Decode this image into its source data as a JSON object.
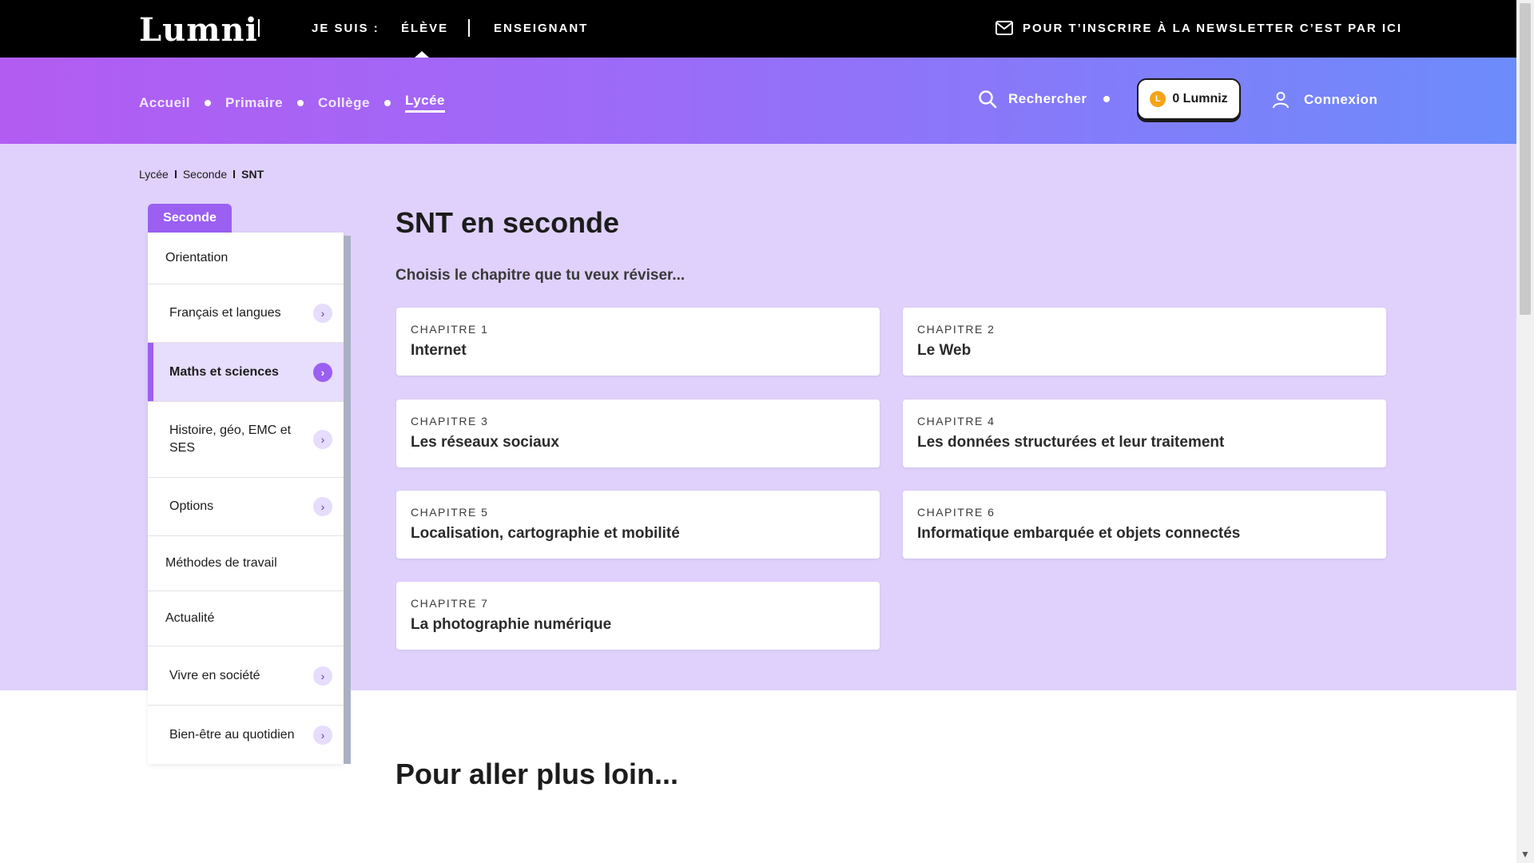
{
  "topbar": {
    "logo": "Lumni",
    "je_suis": "JE SUIS :",
    "eleve": "ÉLÈVE",
    "enseignant": "ENSEIGNANT",
    "newsletter": "POUR T’INSCRIRE À LA NEWSLETTER C’EST PAR ICI"
  },
  "nav": {
    "links": [
      "Accueil",
      "Primaire",
      "Collège",
      "Lycée"
    ],
    "active": "Lycée",
    "search": "Rechercher",
    "lumniz": "0 Lumniz",
    "coin_letter": "L",
    "connexion": "Connexion"
  },
  "breadcrumb": [
    "Lycée",
    "Seconde",
    "SNT"
  ],
  "sidebar": {
    "tab": "Seconde",
    "items": [
      {
        "label": "Orientation",
        "chevron": false
      },
      {
        "label": "Français et langues",
        "chevron": true
      },
      {
        "label": "Maths et sciences",
        "chevron": true,
        "active": true
      },
      {
        "label": "Histoire, géo, EMC et SES",
        "chevron": true
      },
      {
        "label": "Options",
        "chevron": true
      },
      {
        "label": "Méthodes de travail",
        "chevron": false
      },
      {
        "label": "Actualité",
        "chevron": false
      },
      {
        "label": "Vivre en société",
        "chevron": true
      },
      {
        "label": "Bien-être au quotidien",
        "chevron": true
      }
    ]
  },
  "main": {
    "title": "SNT en seconde",
    "subtitle": "Choisis le chapitre que tu veux réviser...",
    "chapters": [
      {
        "num": "CHAPITRE 1",
        "name": "Internet"
      },
      {
        "num": "CHAPITRE 2",
        "name": "Le Web"
      },
      {
        "num": "CHAPITRE 3",
        "name": "Les réseaux sociaux"
      },
      {
        "num": "CHAPITRE 4",
        "name": "Les données structurées et leur traitement"
      },
      {
        "num": "CHAPITRE 5",
        "name": "Localisation, cartographie et mobilité"
      },
      {
        "num": "CHAPITRE 6",
        "name": "Informatique embarquée et objets connectés"
      },
      {
        "num": "CHAPITRE 7",
        "name": "La photographie numérique"
      }
    ],
    "more_title": "Pour aller plus loin..."
  },
  "colors": {
    "accent": "#9b5ff2",
    "hero_bg": "#dfd1fb",
    "coin": "#f4a417"
  }
}
